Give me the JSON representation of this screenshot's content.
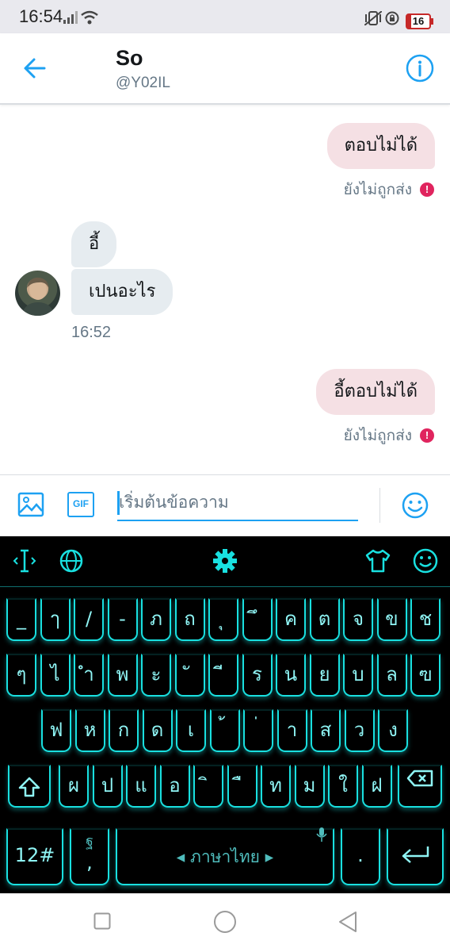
{
  "status_bar": {
    "time": "16:54",
    "battery": "16"
  },
  "header": {
    "name": "So",
    "handle": "@Y02IL"
  },
  "messages": {
    "out_1": "ตอบไม่ได้",
    "out_1_status": "ยังไม่ถูกส่ง",
    "in_1": "อี้",
    "in_2": "เปนอะไร",
    "in_time": "16:52",
    "out_2": "อี้ตอบไม่ได้",
    "out_2_status": "ยังไม่ถูกส่ง"
  },
  "composer": {
    "placeholder": "เริ่มต้นข้อความ",
    "gif_label": "GIF"
  },
  "keyboard": {
    "row1": [
      "_",
      "ๅ",
      "/",
      "-",
      "ภ",
      "ถ",
      "ุ",
      "ึ",
      "ค",
      "ต",
      "จ",
      "ข",
      "ช"
    ],
    "row2": [
      "ๆ",
      "ไ",
      "ำ",
      "พ",
      "ะ",
      "ั",
      "ี",
      "ร",
      "น",
      "ย",
      "บ",
      "ล",
      "ฃ"
    ],
    "row3": [
      "ฟ",
      "ห",
      "ก",
      "ด",
      "เ",
      "้",
      "่",
      "า",
      "ส",
      "ว",
      "ง"
    ],
    "row4": [
      "ผ",
      "ป",
      "แ",
      "อ",
      "ิ",
      "ื",
      "ท",
      "ม",
      "ใ",
      "ฝ"
    ],
    "num_label": "12#",
    "comma_label": ",",
    "comma_alt": "ฐ",
    "space_label": "ภาษาไทย",
    "period_label": "."
  },
  "colors": {
    "accent": "#1da1f2",
    "keyboard_neon": "#19e0e0",
    "error": "#e0245e"
  }
}
